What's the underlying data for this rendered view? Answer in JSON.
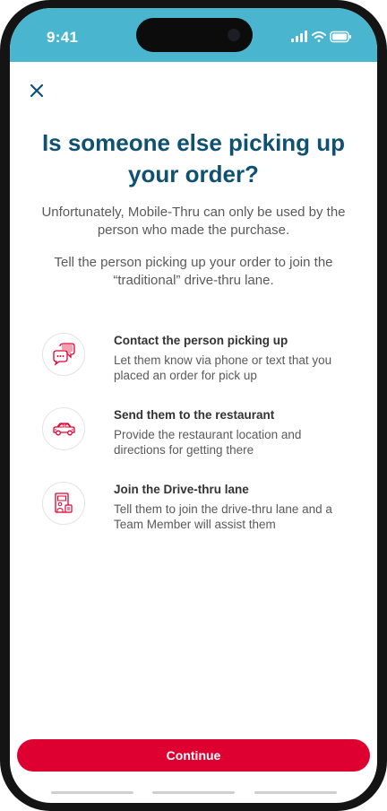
{
  "status_bar": {
    "time": "9:41"
  },
  "header": {
    "close_icon": "close-x-icon"
  },
  "title": "Is someone else picking up your order?",
  "paragraphs": [
    "Unfortunately, Mobile-Thru can only be used by the person who made the purchase.",
    "Tell the person picking up your order to join the “traditional” drive-thru lane."
  ],
  "steps": [
    {
      "icon": "chat-bubbles-icon",
      "title": "Contact the person picking up",
      "description": "Let them know via phone or text that you placed an order for pick up"
    },
    {
      "icon": "car-icon",
      "title": "Send them to the restaurant",
      "description": "Provide the restaurant location and directions for getting there"
    },
    {
      "icon": "drive-thru-kiosk-icon",
      "title": "Join the Drive-thru lane",
      "description": "Tell them to join the drive-thru lane and a Team Member will assist them"
    }
  ],
  "continue_label": "Continue",
  "colors": {
    "status_bar": "#4ab5cf",
    "title": "#0f5173",
    "accent": "#dd0031",
    "icon": "#dd0031"
  }
}
